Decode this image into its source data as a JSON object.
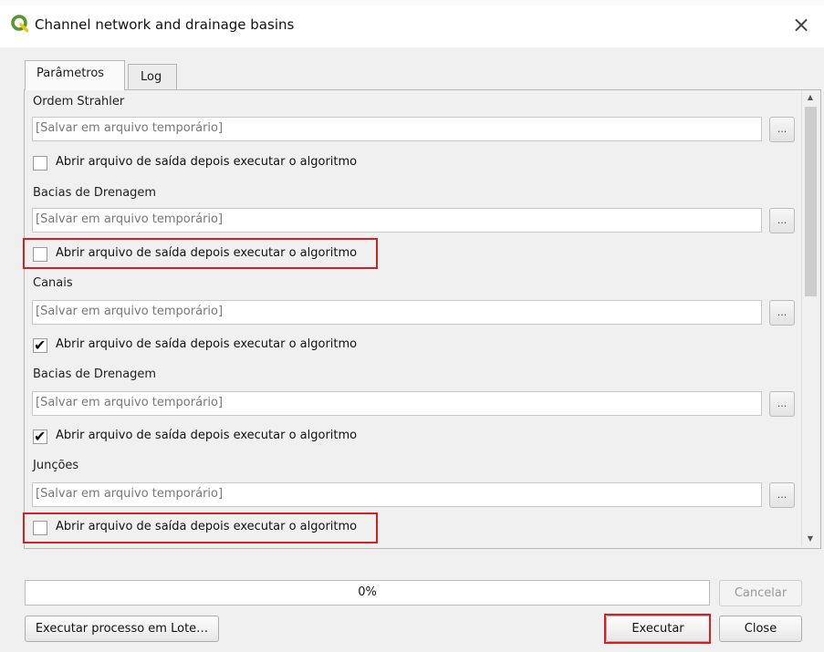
{
  "window": {
    "title": "Channel network and drainage basins",
    "app_icon": "qgis-logo-icon",
    "close_glyph": "×"
  },
  "tabs": [
    {
      "label": "Parâmetros",
      "active": true
    },
    {
      "label": "Log",
      "active": false
    }
  ],
  "sections": [
    {
      "label": "Ordem Strahler",
      "placeholder": "[Salvar em arquivo temporário]",
      "browse": "...",
      "checkbox_label": "Abrir arquivo de saída depois executar o algoritmo",
      "checked": false,
      "highlighted": false
    },
    {
      "label": "Bacias de Drenagem",
      "placeholder": "[Salvar em arquivo temporário]",
      "browse": "...",
      "checkbox_label": "Abrir arquivo de saída depois executar o algoritmo",
      "checked": false,
      "highlighted": true
    },
    {
      "label": "Canais",
      "placeholder": "[Salvar em arquivo temporário]",
      "browse": "...",
      "checkbox_label": "Abrir arquivo de saída depois executar o algoritmo",
      "checked": true,
      "highlighted": false
    },
    {
      "label": "Bacias de Drenagem",
      "placeholder": "[Salvar em arquivo temporário]",
      "browse": "...",
      "checkbox_label": "Abrir arquivo de saída depois executar o algoritmo",
      "checked": true,
      "highlighted": false
    },
    {
      "label": "Junções",
      "placeholder": "[Salvar em arquivo temporário]",
      "browse": "...",
      "checkbox_label": "Abrir arquivo de saída depois executar o algoritmo",
      "checked": false,
      "highlighted": true
    }
  ],
  "progress": {
    "text": "0%",
    "value": 0
  },
  "buttons": {
    "cancel": "Cancelar",
    "batch": "Executar processo em Lote…",
    "run": "Executar",
    "close": "Close"
  },
  "colors": {
    "highlight": "#d32027",
    "qgis_green": "#589632",
    "qgis_yellow": "#eec90d"
  }
}
